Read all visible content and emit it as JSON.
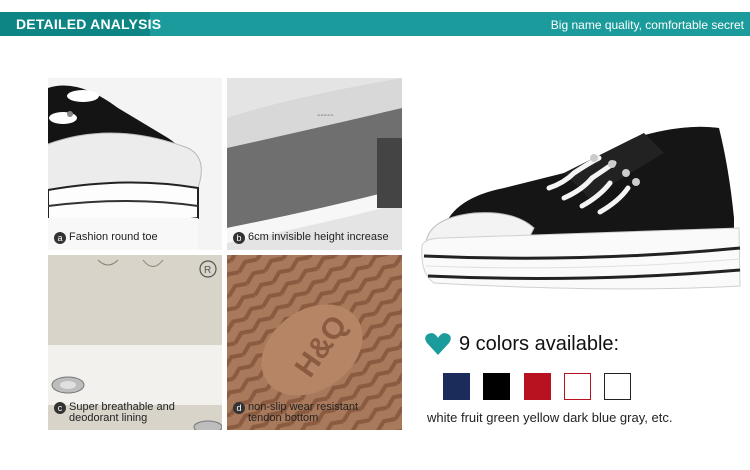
{
  "header": {
    "title": "DETAILED ANALYSIS",
    "slogan": "Big name quality, comfortable secret"
  },
  "details": [
    {
      "badge": "a",
      "caption": "Fashion round toe"
    },
    {
      "badge": "b",
      "caption": "6cm invisible height increase"
    },
    {
      "badge": "c",
      "caption_line1": "Super breathable and",
      "caption_line2": "deodorant lining"
    },
    {
      "badge": "d",
      "caption_line1": "non-slip wear resistant",
      "caption_line2": "tendon bottom"
    }
  ],
  "colors": {
    "heading": "9 colors available:",
    "note": "white fruit green yellow dark blue gray, etc.",
    "swatches": [
      {
        "name": "dark-blue",
        "fill": "#1c2c5a",
        "border": "#1c2c5a"
      },
      {
        "name": "black",
        "fill": "#000000",
        "border": "#000000"
      },
      {
        "name": "red",
        "fill": "#b8111f",
        "border": "#b8111f"
      },
      {
        "name": "white-red-trim",
        "fill": "#ffffff",
        "border": "#b8111f"
      },
      {
        "name": "white",
        "fill": "#ffffff",
        "border": "#222222"
      }
    ],
    "accent": "#1b9b9b"
  }
}
